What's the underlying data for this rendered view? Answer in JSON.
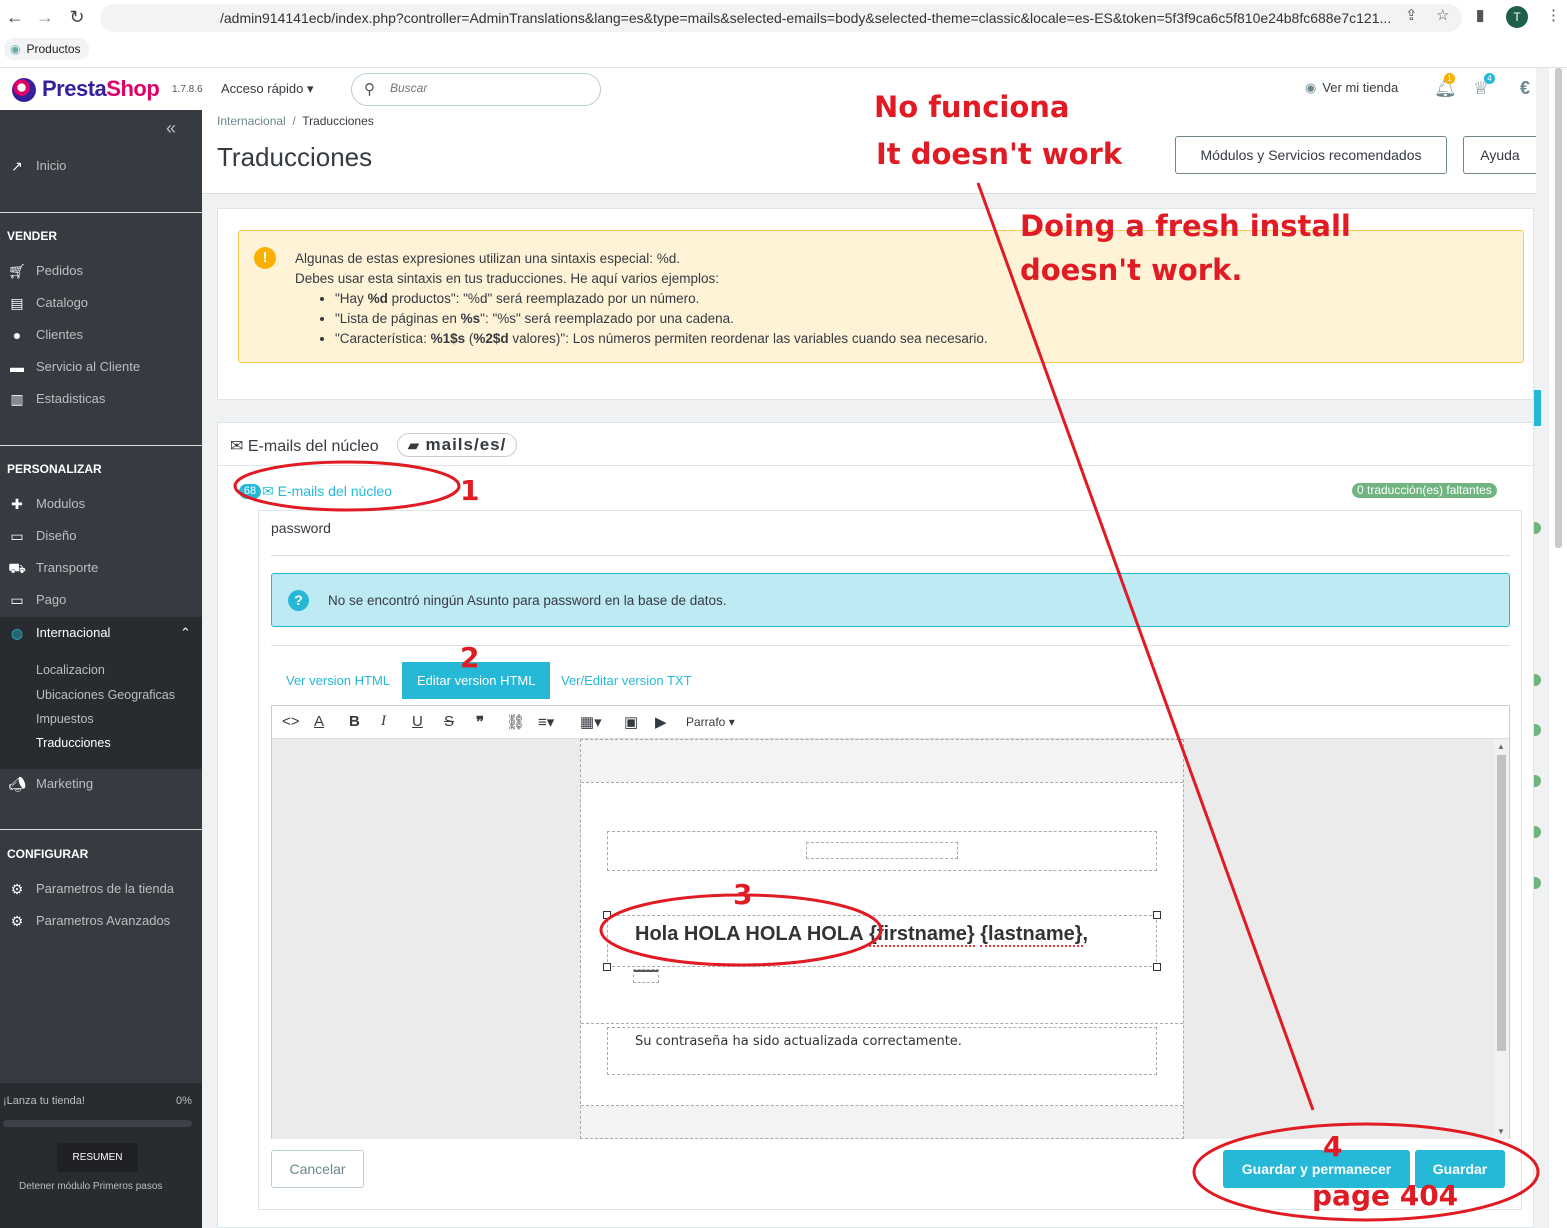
{
  "browser": {
    "url": "/admin914141ecb/index.php?controller=AdminTranslations&lang=es&type=mails&selected-emails=body&selected-theme=classic&locale=es-ES&token=5f3f9ca6c5f810e24b8fc688e7c121...",
    "bookmark": "Productos",
    "profile": "T"
  },
  "header": {
    "brand_a": "Presta",
    "brand_b": "Shop",
    "version": "1.7.8.6",
    "quick_access": "Acceso rápido",
    "search_placeholder": "Buscar",
    "view_store": "Ver mi tienda",
    "notif_count": "1",
    "trophy_count": "4"
  },
  "sidebar": {
    "home": "Inicio",
    "sell_section": "VENDER",
    "sell": [
      "Pedidos",
      "Catalogo",
      "Clientes",
      "Servicio al Cliente",
      "Estadisticas"
    ],
    "customize_section": "PERSONALIZAR",
    "customize": [
      "Modulos",
      "Diseño",
      "Transporte",
      "Pago",
      "Internacional"
    ],
    "international_sub": [
      "Localizacion",
      "Ubicaciones Geograficas",
      "Impuestos",
      "Traducciones"
    ],
    "marketing": "Marketing",
    "configure_section": "CONFIGURAR",
    "configure": [
      "Parametros de la tienda",
      "Parametros Avanzados"
    ],
    "launch_label": "¡Lanza tu tienda!",
    "launch_pct": "0%",
    "launch_progress": 0,
    "resumen": "RESUMEN",
    "stop_module": "Detener módulo Primeros pasos"
  },
  "page": {
    "breadcrumb_parent": "Internacional",
    "breadcrumb_sep": "/",
    "breadcrumb_current": "Traducciones",
    "title": "Traducciones",
    "btn_modules": "Módulos y Servicios recomendados",
    "btn_help": "Ayuda"
  },
  "warning": {
    "line1": "Algunas de estas expresiones utilizan una sintaxis especial: %d.",
    "line2": "Debes usar esta sintaxis en tus traducciones. He aquí varios ejemplos:",
    "b1_pre": "\"Hay ",
    "b1_bold": "%d",
    "b1_post": " productos\": \"%d\" será reemplazado por un número.",
    "b2_pre": "\"Lista de páginas en ",
    "b2_bold": "%s",
    "b2_post": "\": \"%s\" será reemplazado por una cadena.",
    "b3_pre": "\"Característica: ",
    "b3_bold1": "%1$s",
    "b3_mid": " (",
    "b3_bold2": "%2$d",
    "b3_post": " valores)\": Los números permiten reordenar las variables cuando sea necesario."
  },
  "emails": {
    "panel_title": "E-mails del núcleo",
    "path": "mails/es/",
    "count": "68",
    "link": "E-mails del núcleo",
    "missing": "0 traducción(es) faltantes",
    "template_name": "password",
    "info": "No se encontró ningún Asunto para password en la base de datos.",
    "tabs": [
      "Ver version HTML",
      "Editar version HTML",
      "Ver/Editar version TXT"
    ],
    "paragraph": "Parrafo",
    "greeting_text": "Hola HOLA HOLA HOLA",
    "greeting_vars_a": "{firstname}",
    "greeting_vars_b": "{lastname}",
    "greeting_comma": ",",
    "success_text": "Su contraseña ha sido actualizada correctamente.",
    "cancel": "Cancelar",
    "save_stay": "Guardar y permanecer",
    "save": "Guardar"
  },
  "annotations": {
    "no_funciona": "No funciona",
    "doesnt_work": "It doesn't work",
    "fresh1": "Doing a fresh install",
    "fresh2": "doesn't work.",
    "n1": "1",
    "n2": "2",
    "n3": "3",
    "n4": "4",
    "page404": "page 404"
  },
  "colors": {
    "accent": "#25b9d7",
    "sidebar": "#363a41",
    "annotation": "#e01b24",
    "warning_bg": "#fff3d7",
    "success": "#70b580"
  }
}
